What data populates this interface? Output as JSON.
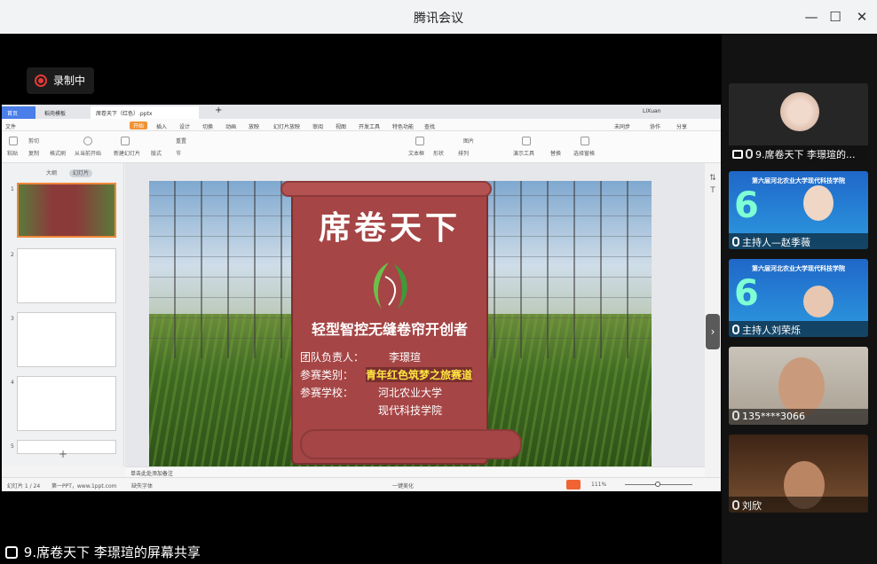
{
  "window": {
    "title": "腾讯会议"
  },
  "recording": {
    "label": "录制中"
  },
  "presentation": {
    "tabs": [
      "首页",
      "稻壳模板",
      "席卷天下（红色）.pptx"
    ],
    "user": "LIXuan",
    "ribbon": [
      "文件",
      "开始",
      "插入",
      "设计",
      "切换",
      "动画",
      "放映",
      "幻灯片放映",
      "审阅",
      "视图",
      "开发工具",
      "特色功能",
      "查找"
    ],
    "ribbon_right": [
      "未同步",
      "协作",
      "分享"
    ],
    "tools": [
      "粘贴",
      "剪切",
      "复制",
      "格式刷",
      "从当前开始",
      "新建幻灯片",
      "版式",
      "节",
      "重置",
      "文本框",
      "形状",
      "排列",
      "图片",
      "演示工具",
      "替换",
      "选择窗格"
    ],
    "panel_tabs": [
      "大纲",
      "幻灯片"
    ],
    "thumb_numbers": [
      "1",
      "2",
      "3",
      "4",
      "5"
    ],
    "slide": {
      "title": "席卷天下",
      "subtitle": "轻型智控无缝卷帘开创者",
      "leader_label": "团队负责人：",
      "leader": "李璟瑄",
      "category_label": "参赛类别：",
      "category": "青年红色筑梦之旅赛道",
      "school_label": "参赛学校：",
      "school_1": "河北农业大学",
      "school_2": "现代科技学院"
    },
    "notes_placeholder": "单击此处添加备注",
    "status": {
      "slide_counter": "幻灯片 1 / 24",
      "theme": "第一PPT，www.1ppt.com",
      "font_missing": "缺失字体",
      "beautify": "一键美化",
      "zoom": "111%"
    }
  },
  "share_caption": "9.席卷天下 李璟瑄的屏幕共享",
  "participants": [
    {
      "name": "9.席卷天下 李璟瑄的...",
      "sharing": true
    },
    {
      "name": "主持人—赵季薇",
      "sharing": false,
      "poster_text": "第六届河北农业大学现代科技学院"
    },
    {
      "name": "主持人刘荣烁",
      "sharing": false,
      "poster_text": "第六届河北农业大学现代科技学院"
    },
    {
      "name": "135****3066",
      "sharing": false
    },
    {
      "name": "刘欣",
      "sharing": false
    }
  ],
  "colors": {
    "accent": "#f0863b",
    "scroll_red": "#a64545",
    "highlight": "#ffe640"
  }
}
